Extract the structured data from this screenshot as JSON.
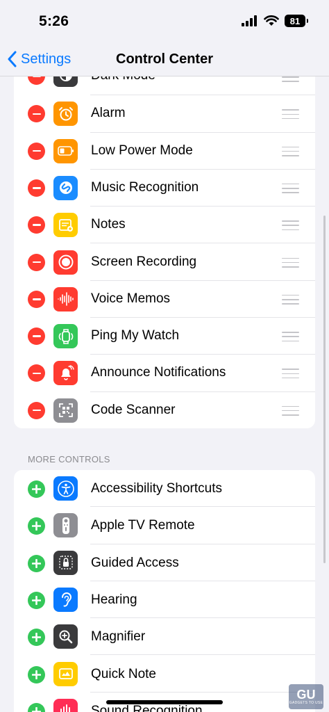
{
  "status_bar": {
    "time": "5:26",
    "battery": "81"
  },
  "nav": {
    "back_label": "Settings",
    "title": "Control Center"
  },
  "included_controls": [
    {
      "label": "Dark Mode",
      "icon": "dark-mode-icon",
      "color": "#3a3a3c"
    },
    {
      "label": "Alarm",
      "icon": "alarm-clock-icon",
      "color": "#ff9500"
    },
    {
      "label": "Low Power Mode",
      "icon": "battery-icon",
      "color": "#ff9500"
    },
    {
      "label": "Music Recognition",
      "icon": "shazam-icon",
      "color": "#1a8cff"
    },
    {
      "label": "Notes",
      "icon": "notes-icon",
      "color": "#ffcc00"
    },
    {
      "label": "Screen Recording",
      "icon": "record-icon",
      "color": "#ff3b30"
    },
    {
      "label": "Voice Memos",
      "icon": "waveform-icon",
      "color": "#ff3b30"
    },
    {
      "label": "Ping My Watch",
      "icon": "watch-icon",
      "color": "#34c759"
    },
    {
      "label": "Announce Notifications",
      "icon": "bell-icon",
      "color": "#ff3b30"
    },
    {
      "label": "Code Scanner",
      "icon": "qr-code-icon",
      "color": "#8e8e93"
    }
  ],
  "more_controls_header": "MORE CONTROLS",
  "more_controls": [
    {
      "label": "Accessibility Shortcuts",
      "icon": "accessibility-icon",
      "color": "#0a7aff"
    },
    {
      "label": "Apple TV Remote",
      "icon": "tv-remote-icon",
      "color": "#8e8e93"
    },
    {
      "label": "Guided Access",
      "icon": "lock-icon",
      "color": "#3a3a3c"
    },
    {
      "label": "Hearing",
      "icon": "ear-icon",
      "color": "#0a7aff"
    },
    {
      "label": "Magnifier",
      "icon": "magnifier-icon",
      "color": "#3a3a3c"
    },
    {
      "label": "Quick Note",
      "icon": "quick-note-icon",
      "color": "#ffcc00"
    },
    {
      "label": "Sound Recognition",
      "icon": "sound-recognition-icon",
      "color": "#ff2d55"
    }
  ],
  "watermark": {
    "logo": "GU",
    "text": "GADGETS TO USE"
  }
}
